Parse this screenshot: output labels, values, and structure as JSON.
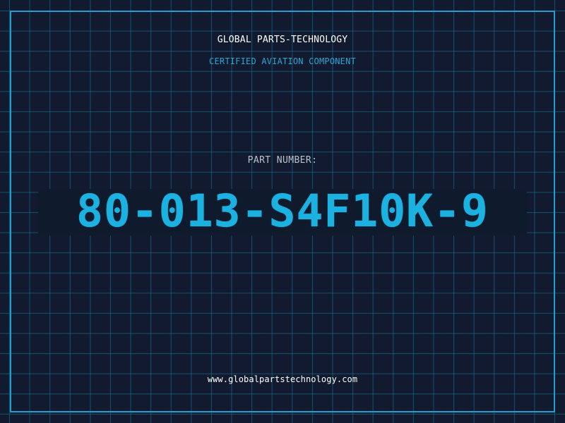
{
  "header": {
    "company_name": "GLOBAL PARTS-TECHNOLOGY",
    "subtitle": "CERTIFIED AVIATION COMPONENT"
  },
  "part": {
    "label": "PART NUMBER:",
    "number": "80-013-S4F10K-9"
  },
  "footer": {
    "website": "www.globalpartstechnology.com"
  },
  "colors": {
    "background": "#111a2e",
    "grid": "#14829f",
    "frame": "#1f9ed0",
    "accent": "#1bb1e1",
    "label": "#b8c2cf",
    "text": "#ffffff"
  }
}
